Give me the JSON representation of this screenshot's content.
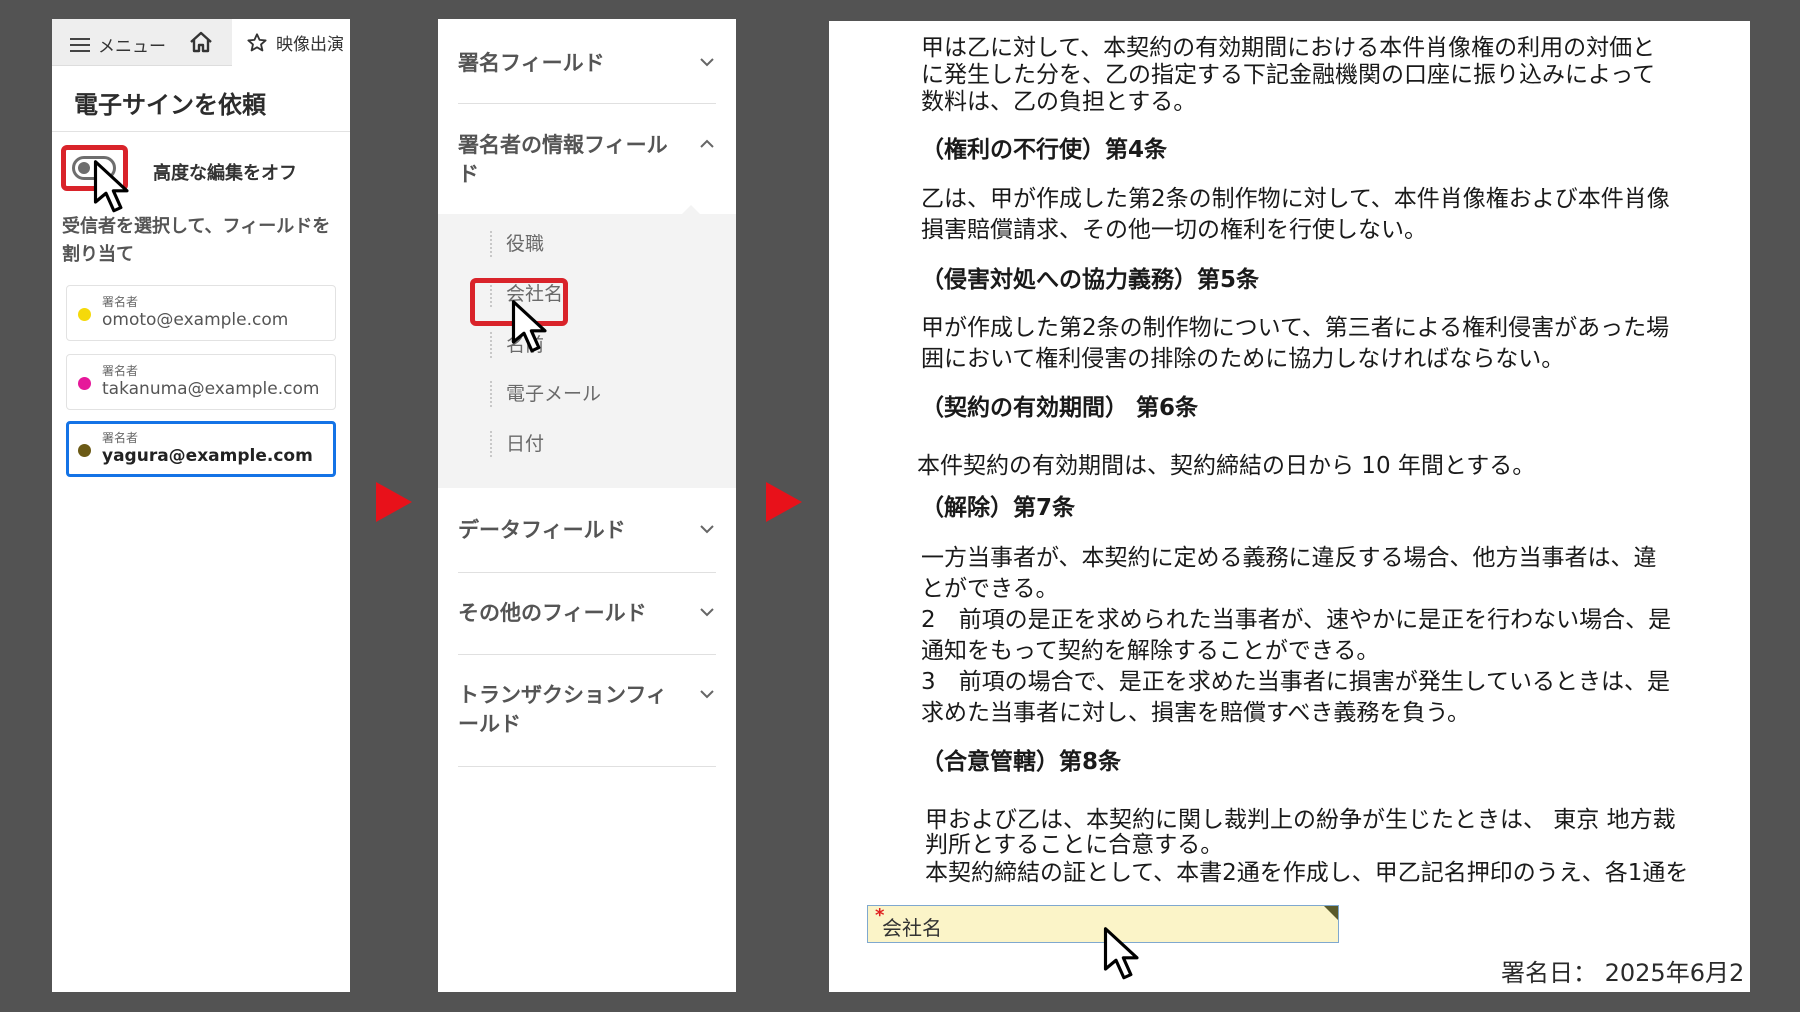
{
  "panel1": {
    "menu_label": "メニュー",
    "tab_label": "映像出演",
    "title": "電子サインを依頼",
    "toggle_label": "高度な編集をオフ",
    "instruction_line1": "受信者を選択して、フィールドを",
    "instruction_line2": "割り当て",
    "signers": [
      {
        "role": "署名者",
        "email": "omoto@example.com",
        "color": "#f5d90a",
        "selected": false
      },
      {
        "role": "署名者",
        "email": "takanuma@example.com",
        "color": "#e6189a",
        "selected": false
      },
      {
        "role": "署名者",
        "email": "yagura@example.com",
        "color": "#6b5a16",
        "selected": true
      }
    ]
  },
  "panel2": {
    "sections": {
      "signature_fields": "署名フィールド",
      "signer_info_line1": "署名者の情報フィール",
      "signer_info_line2": "ド",
      "data_fields": "データフィールド",
      "other_fields": "その他のフィールド",
      "transaction_line1": "トランザクションフィ",
      "transaction_line2": "ールド"
    },
    "signer_info_items": [
      "役職",
      "会社名",
      "名前",
      "電子メール",
      "日付"
    ],
    "highlighted_item": "会社名"
  },
  "panel3": {
    "lines": [
      "甲は乙に対して、本契約の有効期間における本件肖像権の利用の対価と",
      "に発生した分を、乙の指定する下記金融機関の口座に振り込みによって",
      "数料は、乙の負担とする。",
      "（権利の不行使）第4条",
      "乙は、甲が作成した第2条の制作物に対して、本件肖像権および本件肖像",
      "損害賠償請求、その他一切の権利を行使しない。",
      "（侵害対処への協力義務）第5条",
      "甲が作成した第2条の制作物について、第三者による権利侵害があった場",
      "囲において権利侵害の排除のために協力しなければならない。",
      "（契約の有効期間） 第6条",
      "本件契約の有効期間は、契約締結の日から 10 年間とする。",
      "（解除）第7条",
      "一方当事者が、本契約に定める義務に違反する場合、他方当事者は、違",
      "とができる。",
      "2　前項の是正を求められた当事者が、速やかに是正を行わない場合、是",
      "通知をもって契約を解除することができる。",
      "3　前項の場合で、是正を求めた当事者に損害が発生しているときは、是",
      "求めた当事者に対し、損害を賠償すべき義務を負う。",
      "（合意管轄）第8条",
      "甲および乙は、本契約に関し裁判上の紛争が生じたときは、 東京 地方裁",
      "判所とすることに合意する。",
      "本契約締結の証として、本書2通を作成し、甲乙記名押印のうえ、各1通を"
    ],
    "field": {
      "required_mark": "*",
      "label": "会社名"
    },
    "sign_date": "署名日： 2025年6月2"
  },
  "colors": {
    "background": "#535353",
    "highlight_red": "#d9232a",
    "arrow_red": "#e8111a",
    "selected_blue": "#1473e6",
    "field_yellow": "#fbf4c8"
  },
  "icons": [
    "hamburger-icon",
    "home-icon",
    "star-icon",
    "chevron-down-icon",
    "chevron-up-icon",
    "cursor-icon",
    "arrow-right-icon"
  ]
}
